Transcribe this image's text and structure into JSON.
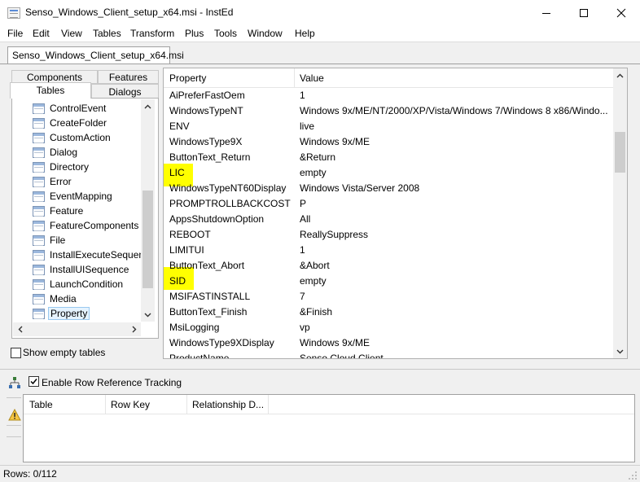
{
  "window": {
    "title": "Senso_Windows_Client_setup_x64.msi - InstEd"
  },
  "menu": [
    "File",
    "Edit",
    "View",
    "Tables",
    "Transform",
    "Plus",
    "Tools",
    "Window",
    "Help"
  ],
  "document_tab": "Senso_Windows_Client_setup_x64.msi",
  "left_tabs": {
    "components": "Components",
    "features": "Features",
    "tables": "Tables",
    "dialogs": "Dialogs"
  },
  "tables_list": [
    "ControlEvent",
    "CreateFolder",
    "CustomAction",
    "Dialog",
    "Directory",
    "Error",
    "EventMapping",
    "Feature",
    "FeatureComponents",
    "File",
    "InstallExecuteSequen",
    "InstallUISequence",
    "LaunchCondition",
    "Media",
    "Property"
  ],
  "selected_table": "Property",
  "show_empty_tables": {
    "label": "Show empty tables",
    "checked": false
  },
  "grid": {
    "columns": [
      "Property",
      "Value"
    ],
    "rows": [
      [
        "AiPreferFastOem",
        "1"
      ],
      [
        "WindowsTypeNT",
        "Windows 9x/ME/NT/2000/XP/Vista/Windows 7/Windows 8 x86/Windo..."
      ],
      [
        "ENV",
        "live"
      ],
      [
        "WindowsType9X",
        "Windows 9x/ME"
      ],
      [
        "ButtonText_Return",
        "&Return"
      ],
      [
        "LIC",
        "empty"
      ],
      [
        "WindowsTypeNT60Display",
        "Windows Vista/Server 2008"
      ],
      [
        "PROMPTROLLBACKCOST",
        "P"
      ],
      [
        "AppsShutdownOption",
        "All"
      ],
      [
        "REBOOT",
        "ReallySuppress"
      ],
      [
        "LIMITUI",
        "1"
      ],
      [
        "ButtonText_Abort",
        "&Abort"
      ],
      [
        "SID",
        "empty"
      ],
      [
        "MSIFASTINSTALL",
        "7"
      ],
      [
        "ButtonText_Finish",
        "&Finish"
      ],
      [
        "MsiLogging",
        "vp"
      ],
      [
        "WindowsType9XDisplay",
        "Windows 9x/ME"
      ],
      [
        "ProductName",
        "Senso Cloud Client"
      ]
    ],
    "highlighted_keys": [
      "LIC",
      "SID"
    ],
    "highlight_color": "#ffff00"
  },
  "row_reference": {
    "label": "Enable Row Reference Tracking",
    "checked": true,
    "columns": [
      "Table",
      "Row Key",
      "Relationship D..."
    ]
  },
  "status": "Rows: 0/112"
}
